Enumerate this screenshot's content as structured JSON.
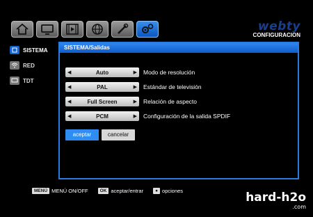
{
  "brand": {
    "logo": "webty",
    "subtitle": "CONFIGURACION"
  },
  "topbar": {
    "icons": [
      "home-icon",
      "tv-icon",
      "film-icon",
      "globe-icon",
      "tools-icon",
      "settings-icon"
    ],
    "active_index": 5
  },
  "sidebar": {
    "items": [
      {
        "label": "SISTEMA",
        "icon": "system-icon",
        "active": true
      },
      {
        "label": "RED",
        "icon": "wifi-icon",
        "active": false
      },
      {
        "label": "TDT",
        "icon": "tv-small-icon",
        "active": false
      }
    ]
  },
  "panel": {
    "title": "SISTEMA/Salidas",
    "rows": [
      {
        "value": "Auto",
        "label": "Modo de resolución"
      },
      {
        "value": "PAL",
        "label": "Estándar de televisión"
      },
      {
        "value": "Full Screen",
        "label": "Relación de aspecto"
      },
      {
        "value": "PCM",
        "label": "Configuración de la salida SPDIF"
      }
    ],
    "accept_label": "aceptar",
    "cancel_label": "cancelar"
  },
  "help": {
    "menu_key": "MENÚ",
    "menu_text": "MENÚ ON/OFF",
    "ok_key": "OK",
    "ok_text": "aceptar/entrar",
    "options_key": "●",
    "options_text": "opciones"
  },
  "watermark": {
    "line1": "hard-h2o",
    "line2": ".com"
  },
  "colors": {
    "accent": "#2f8cf0",
    "panel_border": "#2a7de0",
    "background": "#000000"
  }
}
